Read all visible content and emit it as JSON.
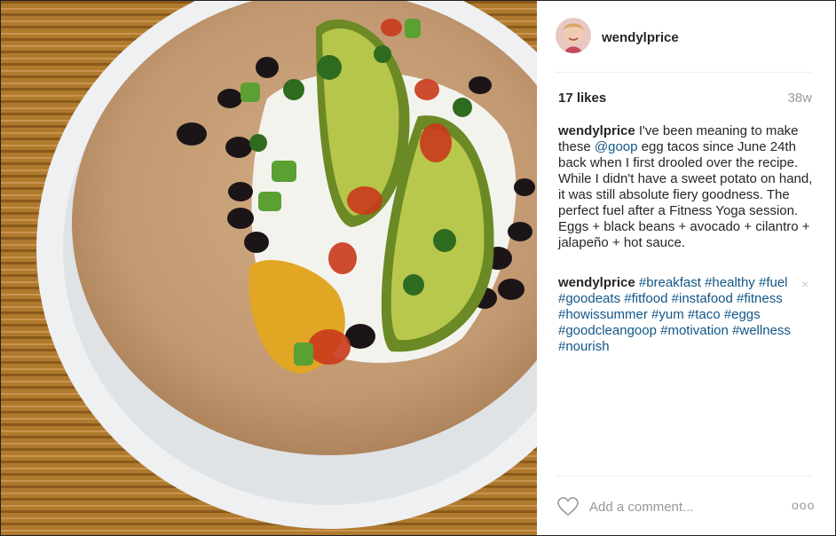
{
  "post": {
    "username": "wendylprice",
    "likes": "17 likes",
    "age": "38w",
    "caption": {
      "user": "wendylprice",
      "t1": " I've been meaning to make these ",
      "mention": "@goop",
      "t2": " egg tacos since June 24th back when I first drooled over the recipe. While I didn't have a sweet potato on hand, it was still absolute fiery goodness. The perfect fuel after a Fitness Yoga session. Eggs + black beans + avocado + cilantro + jalapeño + hot sauce."
    },
    "comment": {
      "user": "wendylprice",
      "tags": [
        "#breakfast",
        "#healthy",
        "#fuel",
        "#goodeats",
        "#fitfood",
        "#instafood",
        "#fitness",
        "#howissummer",
        "#yum",
        "#taco",
        "#eggs",
        "#goodcleangoop",
        "#motivation",
        "#wellness",
        "#nourish"
      ],
      "delete": "×"
    },
    "footer": {
      "placeholder": "Add a comment...",
      "more": "ooo"
    },
    "icons": [
      "heart-icon",
      "more-options-icon"
    ]
  }
}
